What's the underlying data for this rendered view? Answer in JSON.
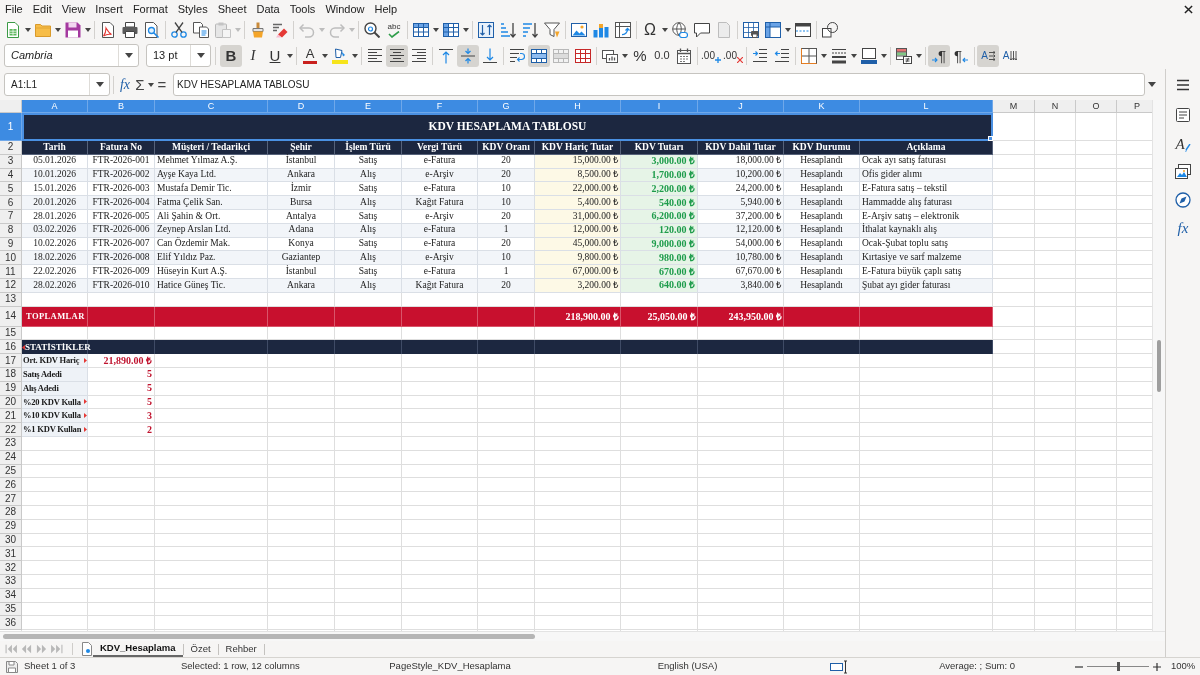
{
  "menu_bar": [
    "File",
    "Edit",
    "View",
    "Insert",
    "Format",
    "Styles",
    "Sheet",
    "Data",
    "Tools",
    "Window",
    "Help"
  ],
  "standard_toolbar": {
    "spelling_glyph": "abc",
    "special_character_glyph": "Ω"
  },
  "formatting_toolbar": {
    "font_name": "Cambria",
    "font_size": "13 pt",
    "styles": [
      {
        "kind": "bold",
        "glyph": "B",
        "on": true
      },
      {
        "kind": "italic",
        "glyph": "I",
        "on": false
      },
      {
        "kind": "underline",
        "glyph": "U",
        "on": false
      }
    ],
    "font_color_glyph": "A",
    "horizontal_align": [
      {
        "selected": false
      },
      {
        "selected": true
      },
      {
        "selected": false
      }
    ],
    "vertical_align": [
      {
        "selected": false
      },
      {
        "selected": true
      },
      {
        "selected": false
      }
    ],
    "merge_and_center": true,
    "number_formats": [
      {
        "kind": "percent",
        "glyph": "%"
      },
      {
        "kind": "number",
        "glyph": "0.0"
      }
    ],
    "decimals": [
      {
        "kind": "add",
        "glyph": ".00"
      },
      {
        "kind": "delete",
        "glyph": ".00"
      }
    ],
    "paragraph_direction": [
      {
        "glyph": "¶",
        "selected": true
      },
      {
        "glyph": "¶",
        "selected": false
      }
    ],
    "text_direction": [
      {
        "glyph": "A",
        "selected": true
      },
      {
        "glyph": "A",
        "selected": false
      }
    ]
  },
  "formula_bar": {
    "name_box": "A1:L1",
    "function_wizard_glyph": "fx",
    "sum_glyph": "Σ",
    "formula_glyph": "=",
    "content": "KDV HESAPLAMA TABLOSU"
  },
  "sheet": {
    "columns": [
      {
        "label": "A",
        "selected": true
      },
      {
        "label": "B",
        "selected": true
      },
      {
        "label": "C",
        "selected": true
      },
      {
        "label": "D",
        "selected": true
      },
      {
        "label": "E",
        "selected": true
      },
      {
        "label": "F",
        "selected": true
      },
      {
        "label": "G",
        "selected": true
      },
      {
        "label": "H",
        "selected": true
      },
      {
        "label": "I",
        "selected": true
      },
      {
        "label": "J",
        "selected": true
      },
      {
        "label": "K",
        "selected": true
      },
      {
        "label": "L",
        "selected": true
      },
      {
        "label": "M",
        "selected": false
      },
      {
        "label": "N",
        "selected": false
      },
      {
        "label": "O",
        "selected": false
      },
      {
        "label": "P",
        "selected": false
      }
    ],
    "rows": [
      {
        "label": "1",
        "selected": true
      },
      {
        "label": "2",
        "selected": false
      },
      {
        "label": "3",
        "selected": false
      },
      {
        "label": "4",
        "selected": false
      },
      {
        "label": "5",
        "selected": false
      },
      {
        "label": "6",
        "selected": false
      },
      {
        "label": "7",
        "selected": false
      },
      {
        "label": "8",
        "selected": false
      },
      {
        "label": "9",
        "selected": false
      },
      {
        "label": "10",
        "selected": false
      },
      {
        "label": "11",
        "selected": false
      },
      {
        "label": "12",
        "selected": false
      },
      {
        "label": "13",
        "selected": false
      },
      {
        "label": "14",
        "selected": false
      },
      {
        "label": "15",
        "selected": false
      },
      {
        "label": "16",
        "selected": false
      },
      {
        "label": "17",
        "selected": false
      },
      {
        "label": "18",
        "selected": false
      },
      {
        "label": "19",
        "selected": false
      },
      {
        "label": "20",
        "selected": false
      },
      {
        "label": "21",
        "selected": false
      },
      {
        "label": "22",
        "selected": false
      },
      {
        "label": "23",
        "selected": false
      },
      {
        "label": "24",
        "selected": false
      },
      {
        "label": "25",
        "selected": false
      },
      {
        "label": "26",
        "selected": false
      },
      {
        "label": "27",
        "selected": false
      },
      {
        "label": "28",
        "selected": false
      },
      {
        "label": "29",
        "selected": false
      },
      {
        "label": "30",
        "selected": false
      },
      {
        "label": "31",
        "selected": false
      },
      {
        "label": "32",
        "selected": false
      },
      {
        "label": "33",
        "selected": false
      },
      {
        "label": "34",
        "selected": false
      },
      {
        "label": "35",
        "selected": false
      },
      {
        "label": "36",
        "selected": false
      }
    ],
    "title": {
      "text": "KDV HESAPLAMA TABLOSU",
      "selected": true
    },
    "header": [
      "Tarih",
      "Fatura No",
      "Müşteri / Tedarikçi",
      "Şehir",
      "İşlem Türü",
      "Vergi Türü",
      "KDV Oranı",
      "KDV Hariç Tutar",
      "KDV Tutarı",
      "KDV Dahil Tutar",
      "KDV Durumu",
      "Açıklama"
    ],
    "data": [
      [
        "05.01.2026",
        "FTR-2026-001",
        "Mehmet Yılmaz A.Ş.",
        "İstanbul",
        "Satış",
        "e-Fatura",
        "20",
        "15,000.00 ₺",
        "3,000.00 ₺",
        "18,000.00 ₺",
        "Hesaplandı",
        "Ocak ayı satış faturası"
      ],
      [
        "10.01.2026",
        "FTR-2026-002",
        "Ayşe Kaya Ltd.",
        "Ankara",
        "Alış",
        "e-Arşiv",
        "20",
        "8,500.00 ₺",
        "1,700.00 ₺",
        "10,200.00 ₺",
        "Hesaplandı",
        "Ofis gider alımı"
      ],
      [
        "15.01.2026",
        "FTR-2026-003",
        "Mustafa Demir Tic.",
        "İzmir",
        "Satış",
        "e-Fatura",
        "10",
        "22,000.00 ₺",
        "2,200.00 ₺",
        "24,200.00 ₺",
        "Hesaplandı",
        "E-Fatura satış – tekstil"
      ],
      [
        "20.01.2026",
        "FTR-2026-004",
        "Fatma Çelik San.",
        "Bursa",
        "Alış",
        "Kağıt Fatura",
        "10",
        "5,400.00 ₺",
        "540.00 ₺",
        "5,940.00 ₺",
        "Hesaplandı",
        "Hammadde alış faturası"
      ],
      [
        "28.01.2026",
        "FTR-2026-005",
        "Ali Şahin & Ort.",
        "Antalya",
        "Satış",
        "e-Arşiv",
        "20",
        "31,000.00 ₺",
        "6,200.00 ₺",
        "37,200.00 ₺",
        "Hesaplandı",
        "E-Arşiv satış – elektronik"
      ],
      [
        "03.02.2026",
        "FTR-2026-006",
        "Zeynep Arslan Ltd.",
        "Adana",
        "Alış",
        "e-Fatura",
        "1",
        "12,000.00 ₺",
        "120.00 ₺",
        "12,120.00 ₺",
        "Hesaplandı",
        "İthalat kaynaklı alış"
      ],
      [
        "10.02.2026",
        "FTR-2026-007",
        "Can Özdemir Mak.",
        "Konya",
        "Satış",
        "e-Fatura",
        "20",
        "45,000.00 ₺",
        "9,000.00 ₺",
        "54,000.00 ₺",
        "Hesaplandı",
        "Ocak-Şubat toplu satış"
      ],
      [
        "18.02.2026",
        "FTR-2026-008",
        "Elif Yıldız Paz.",
        "Gaziantep",
        "Alış",
        "e-Arşiv",
        "10",
        "9,800.00 ₺",
        "980.00 ₺",
        "10,780.00 ₺",
        "Hesaplandı",
        "Kırtasiye ve sarf malzeme"
      ],
      [
        "22.02.2026",
        "FTR-2026-009",
        "Hüseyin Kurt A.Ş.",
        "İstanbul",
        "Satış",
        "e-Fatura",
        "1",
        "67,000.00 ₺",
        "670.00 ₺",
        "67,670.00 ₺",
        "Hesaplandı",
        "E-Fatura büyük çaplı satış"
      ],
      [
        "28.02.2026",
        "FTR-2026-010",
        "Hatice Güneş Tic.",
        "Ankara",
        "Alış",
        "Kağıt Fatura",
        "20",
        "3,200.00 ₺",
        "640.00 ₺",
        "3,840.00 ₺",
        "Hesaplandı",
        "Şubat ayı gider faturası"
      ]
    ],
    "totals": {
      "label": "TOPLAMLAR",
      "values": [
        "218,900.00 ₺",
        "25,050.00 ₺",
        "243,950.00 ₺"
      ]
    },
    "stats_title": {
      "text": "STATİSTİKLER",
      "clipped": true
    },
    "stats": [
      {
        "label": "Ort. KDV Hariç",
        "value": "21,890.00 ₺",
        "clipped": true
      },
      {
        "label": "Satış Adedi",
        "value": "5",
        "clipped": false
      },
      {
        "label": "Alış Adedi",
        "value": "5",
        "clipped": false
      },
      {
        "label": "%20 KDV Kulla",
        "value": "5",
        "clipped": true
      },
      {
        "label": "%10 KDV Kulla",
        "value": "3",
        "clipped": true
      },
      {
        "label": "%1 KDV Kullan",
        "value": "2",
        "clipped": true
      }
    ]
  },
  "sheet_tabs": [
    {
      "label": "KDV_Hesaplama",
      "selected": true
    },
    {
      "label": "Özet",
      "selected": false
    },
    {
      "label": "Rehber",
      "selected": false
    }
  ],
  "sidebar": {
    "styles_glyph": "A",
    "functions_glyph": "fx"
  },
  "status_bar": {
    "sheet": "Sheet 1 of 3",
    "selection": "Selected: 1 row, 12 columns",
    "page_style": "PageStyle_KDV_Hesaplama",
    "language": "English (USA)",
    "summary": "Average: ; Sum: 0",
    "zoom": {
      "level": 0.5,
      "reading": "100%"
    }
  }
}
